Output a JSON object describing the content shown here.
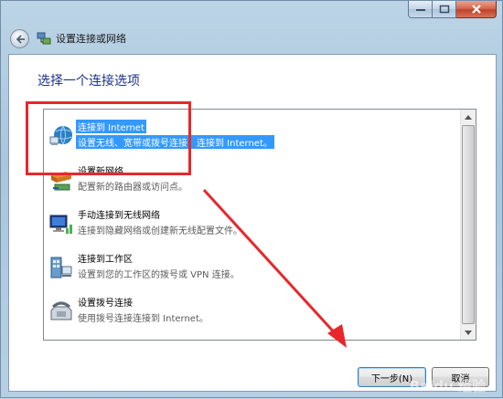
{
  "window": {
    "title": "设置连接或网络"
  },
  "heading": "选择一个连接选项",
  "options": [
    {
      "label": "连接到 Internet",
      "description": "设置无线、宽带或拨号连接，连接到 Internet。",
      "icon": "globe-network-icon",
      "selected": true
    },
    {
      "label": "设置新网络",
      "description": "配置新的路由器或访问点。",
      "icon": "router-icon",
      "selected": false
    },
    {
      "label": "手动连接到无线网络",
      "description": "连接到隐藏网络或创建新无线配置文件。",
      "icon": "wireless-computer-icon",
      "selected": false
    },
    {
      "label": "连接到工作区",
      "description": "设置到您的工作区的拨号或 VPN 连接。",
      "icon": "workplace-building-icon",
      "selected": false
    },
    {
      "label": "设置拨号连接",
      "description": "使用拨号连接连接到 Internet。",
      "icon": "telephone-icon",
      "selected": false
    }
  ],
  "buttons": {
    "next": "下一步(N)",
    "cancel": "取消"
  },
  "watermark": "Baidu 经验",
  "colors": {
    "heading": "#1e3287",
    "selection": "#3399ff",
    "annotation": "#e8272b"
  }
}
